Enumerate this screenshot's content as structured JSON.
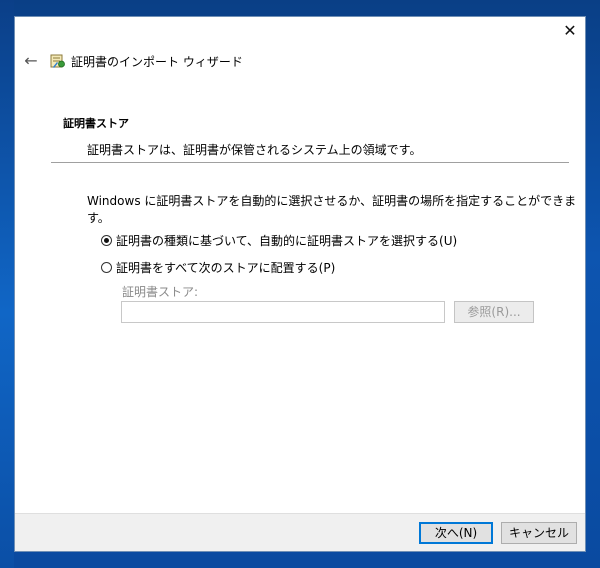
{
  "window": {
    "title": "証明書のインポート ウィザード",
    "close_glyph": "✕",
    "back_glyph": "←"
  },
  "section": {
    "heading": "証明書ストア",
    "description": "証明書ストアは、証明書が保管されるシステム上の領域です。"
  },
  "instruction": "Windows に証明書ストアを自動的に選択させるか、証明書の場所を指定することができます。",
  "options": {
    "auto": {
      "label": "証明書の種類に基づいて、自動的に証明書ストアを選択する(U)",
      "checked": true
    },
    "manual": {
      "label": "証明書をすべて次のストアに配置する(P)",
      "checked": false
    }
  },
  "store": {
    "label": "証明書ストア:",
    "value": "",
    "browse_label": "参照(R)..."
  },
  "footer": {
    "next_label": "次へ(N)",
    "cancel_label": "キャンセル"
  },
  "colors": {
    "accent": "#0078d7",
    "desktop": "#0d55b0"
  },
  "icons": {
    "title": "certificate-icon",
    "back": "back-arrow-icon",
    "close": "close-icon"
  }
}
